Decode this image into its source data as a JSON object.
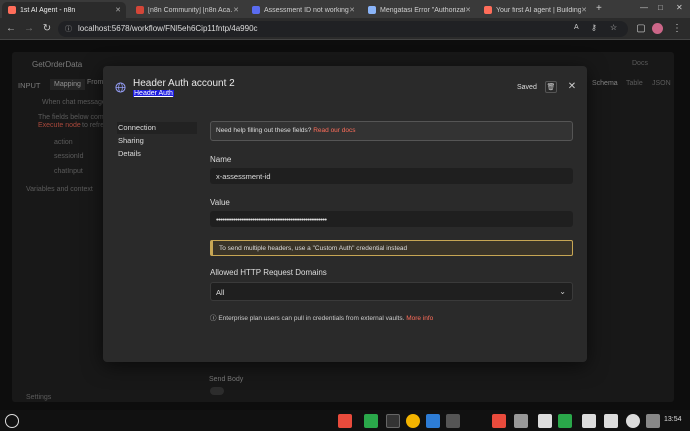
{
  "browser": {
    "tabs": [
      {
        "label": "1st AI Agent - n8n",
        "active": true,
        "color": "#ff6d5a"
      },
      {
        "label": "[n8n Community] [n8n Aca…",
        "active": false,
        "color": "#d44638"
      },
      {
        "label": "Assessment ID not working",
        "active": false,
        "color": "#5a6cf0"
      },
      {
        "label": "Mengatasi Error \"Authorizati…",
        "active": false,
        "color": "#8ab4f8"
      },
      {
        "label": "Your first AI agent | Building…",
        "active": false,
        "color": "#ff6d5a"
      }
    ],
    "url": "localhost:5678/workflow/FNl5eh6Cip11fntp/4a990c"
  },
  "background": {
    "node_title": "GetOrderData",
    "input_label": "INPUT",
    "mapping_tab": "Mapping",
    "from_ai_tab": "From AI",
    "when_chat": "When chat message re…",
    "fields_note": "The fields below come f…",
    "execute_link": "Execute node",
    "refresh_text": "to refresh",
    "fields": [
      "action",
      "sessionId",
      "chatInput"
    ],
    "vars": "Variables and context",
    "docs": "Docs",
    "views": [
      "Schema",
      "Table",
      "JSON"
    ],
    "send_body": "Send Body",
    "settings": "Settings"
  },
  "modal": {
    "title": "Header Auth account 2",
    "subtitle": "Header Auth",
    "saved": "Saved",
    "sidebar": [
      "Connection",
      "Sharing",
      "Details"
    ],
    "hint_text": "Need help filling out these fields?",
    "hint_link": "Read our docs",
    "name_label": "Name",
    "name_value": "x-assessment-id",
    "value_label": "Value",
    "value_masked": "••••••••••••••••••••••••••••••••••••••••••••••••••••",
    "warning": "To send multiple headers, use a \"Custom Auth\" credential instead",
    "domains_label": "Allowed HTTP Request Domains",
    "domains_value": "All",
    "enterprise_text": "Enterprise plan users can pull in credentials from external vaults.",
    "enterprise_link": "More info"
  },
  "taskbar": {
    "time": "13:54",
    "icon_colors": [
      "#e94b3c",
      "#2aa84a",
      "#444",
      "#f4b400",
      "#2d7cd6",
      "#555",
      "#e94b3c",
      "#ddd",
      "#2aa84a",
      "#ddd",
      "#888"
    ]
  }
}
